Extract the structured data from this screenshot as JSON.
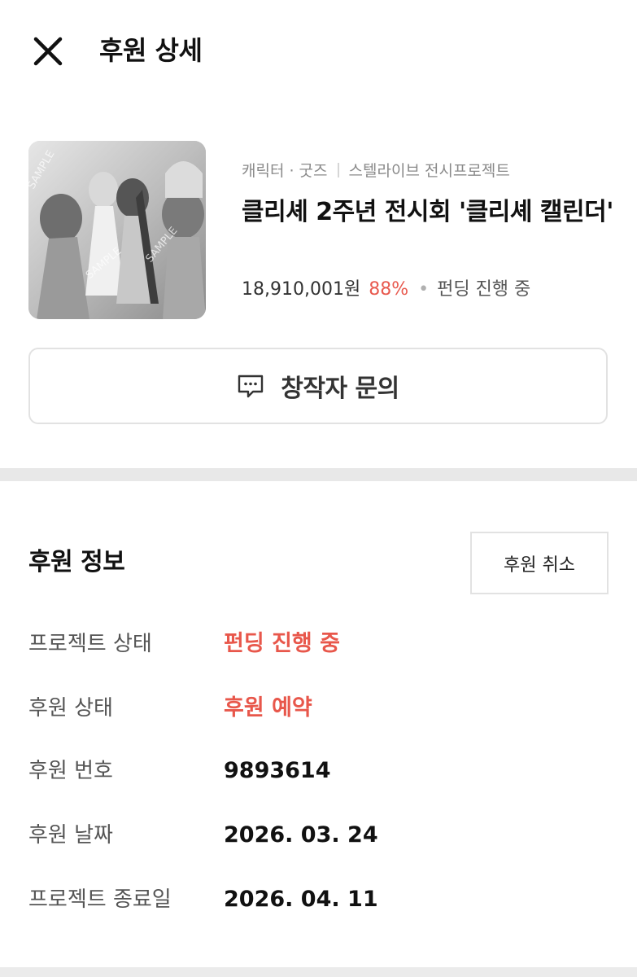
{
  "header": {
    "title": "후원 상세",
    "close_icon": "close-icon"
  },
  "project": {
    "category": "캐릭터 · 굿즈",
    "creator": "스텔라이브 전시프로젝트",
    "title": "클리셰 2주년 전시회 '클리셰 캘린더'",
    "amount": "18,910,001원",
    "percent": "88%",
    "dot": "•",
    "status": "펀딩 진행 중",
    "thumbnail_watermark": "SAMPLE"
  },
  "inquiry": {
    "label": "창작자 문의",
    "icon": "chat-icon"
  },
  "support_info": {
    "title": "후원 정보",
    "cancel_label": "후원 취소",
    "rows": [
      {
        "label": "프로젝트 상태",
        "value": "펀딩 진행 중"
      },
      {
        "label": "후원 상태",
        "value": "후원 예약"
      },
      {
        "label": "후원 번호",
        "value": "9893614"
      },
      {
        "label": "후원 날짜",
        "value": "2026. 03. 24"
      },
      {
        "label": "프로젝트 종료일",
        "value": "2026. 04. 11"
      }
    ]
  },
  "colors": {
    "accent": "#e8574b",
    "text": "#111111",
    "muted": "#8a8a8a",
    "border": "#e2e2e2"
  }
}
